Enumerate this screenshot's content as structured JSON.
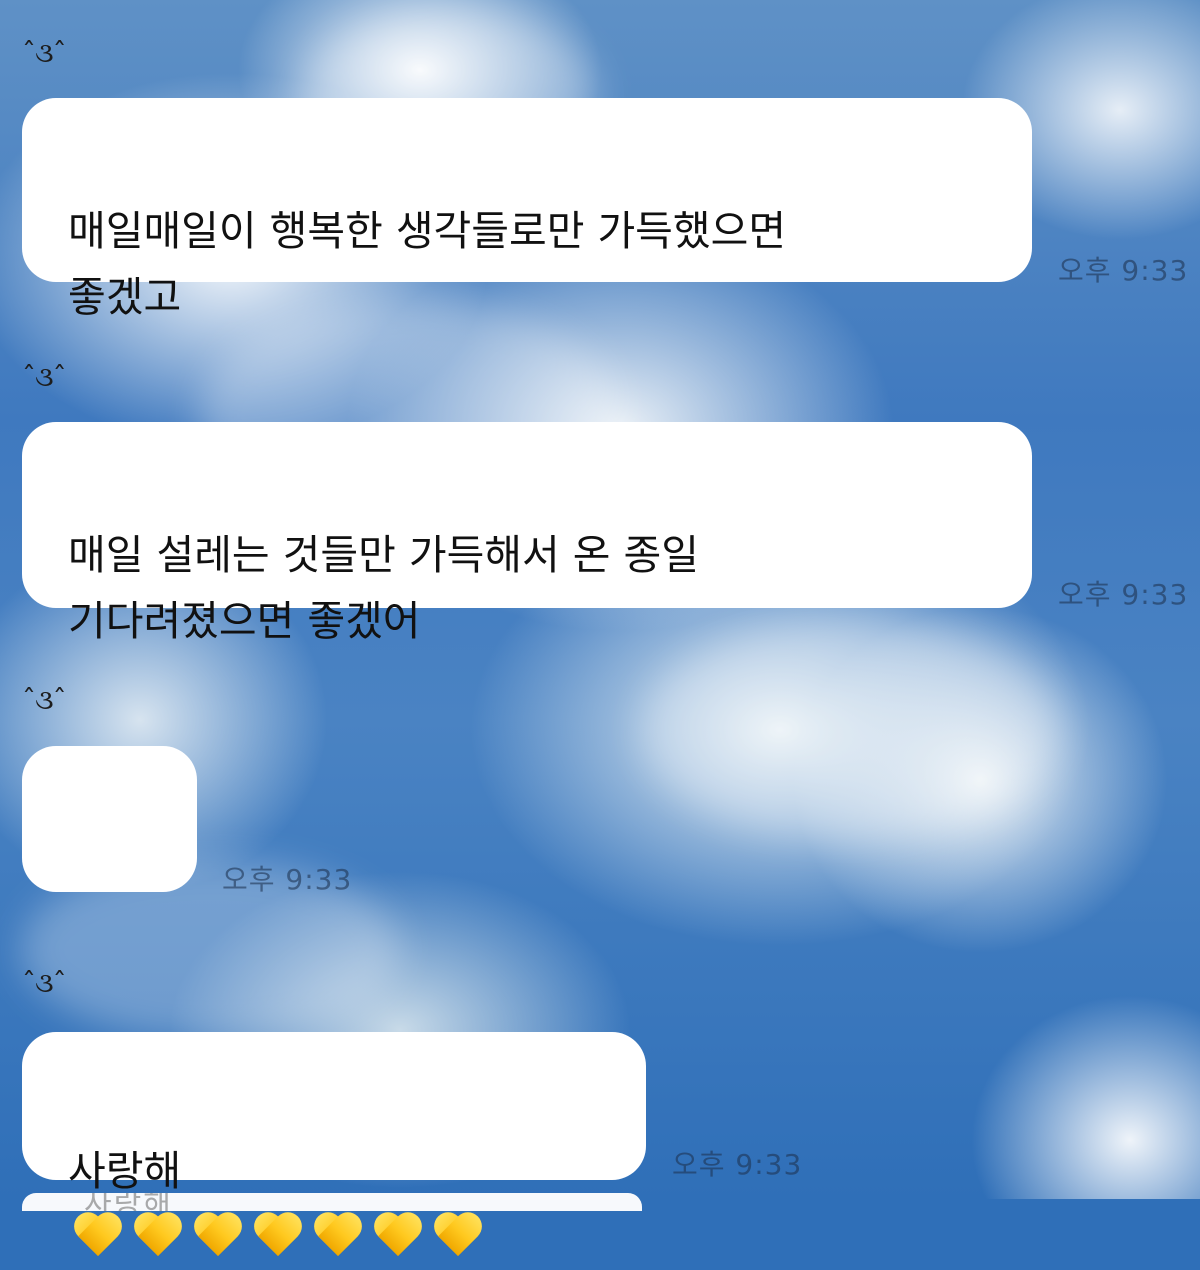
{
  "messages": [
    {
      "sender": "ˆ૩ˆ",
      "text": "매일매일이 행복한 생각들로만 가득했으면\n좋겠고",
      "time": "오후 9:33"
    },
    {
      "sender": "ˆ૩ˆ",
      "text": "매일 설레는 것들만 가득해서 온 종일\n기다려졌으면 좋겠어",
      "time": "오후 9:33"
    },
    {
      "sender": "ˆ૩ˆ",
      "text": "",
      "time": "오후 9:33"
    },
    {
      "sender": "ˆ૩ˆ",
      "text": "사랑해",
      "time": "오후 9:33",
      "emoji": [
        "💛",
        "💛",
        "💛",
        "💛",
        "💛",
        "💛",
        "💛"
      ]
    }
  ],
  "cutoff_message": {
    "text": "사랑해"
  }
}
